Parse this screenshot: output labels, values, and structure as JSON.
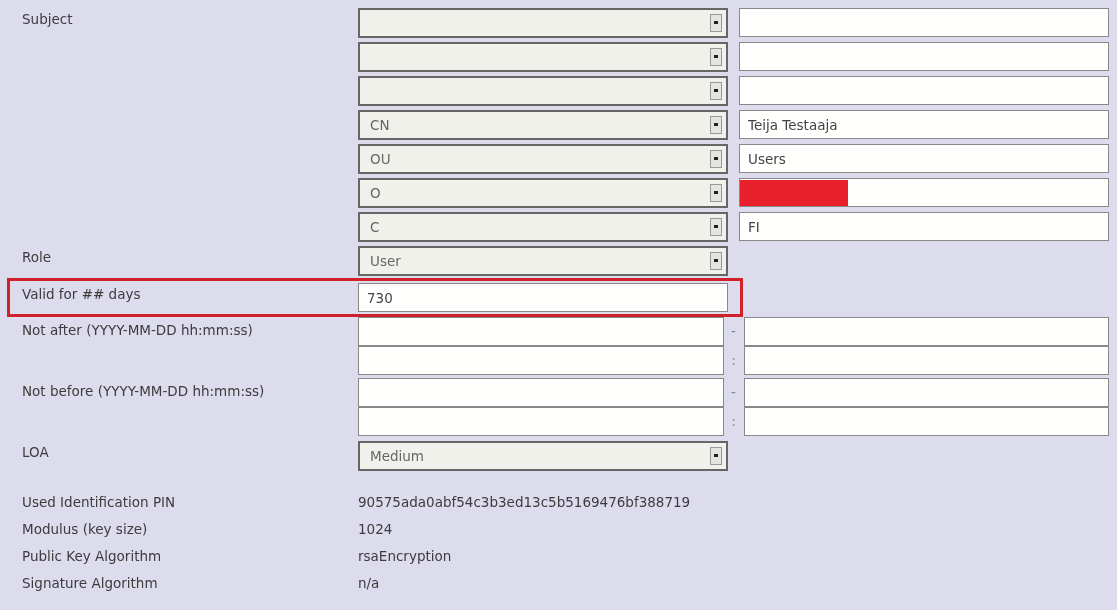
{
  "subject": {
    "label": "Subject",
    "rows": [
      {},
      {},
      {},
      {
        "attribute": "CN",
        "value": "Teija Testaaja"
      },
      {
        "attribute": "OU",
        "value": "Users"
      },
      {
        "attribute": "O",
        "redacted": true
      },
      {
        "attribute": "C",
        "value": "FI"
      }
    ]
  },
  "fields": [
    {
      "kind": "select",
      "label": "Role",
      "value": "User",
      "highlighted": false
    },
    {
      "kind": "text",
      "label": "Valid for ## days",
      "value": "730",
      "highlighted": true
    },
    {
      "kind": "datetime",
      "label": "Not after (YYYY-MM-DD hh:mm:ss)",
      "separators": [
        "-",
        ":"
      ],
      "highlighted": false
    },
    {
      "kind": "datetime",
      "label": "Not before (YYYY-MM-DD hh:mm:ss)",
      "separators": [
        "-",
        ":"
      ],
      "highlighted": false
    },
    {
      "kind": "select",
      "label": "LOA",
      "value": "Medium",
      "highlighted": false
    }
  ],
  "info": [
    {
      "label": "Used Identification PIN",
      "value": "90575ada0abf54c3b3ed13c5b5169476bf388719"
    },
    {
      "label": "Modulus (key size)",
      "value": "1024"
    },
    {
      "label": "Public Key Algorithm",
      "value": "rsaEncryption"
    },
    {
      "label": "Signature Algorithm",
      "value": "n/a"
    }
  ]
}
